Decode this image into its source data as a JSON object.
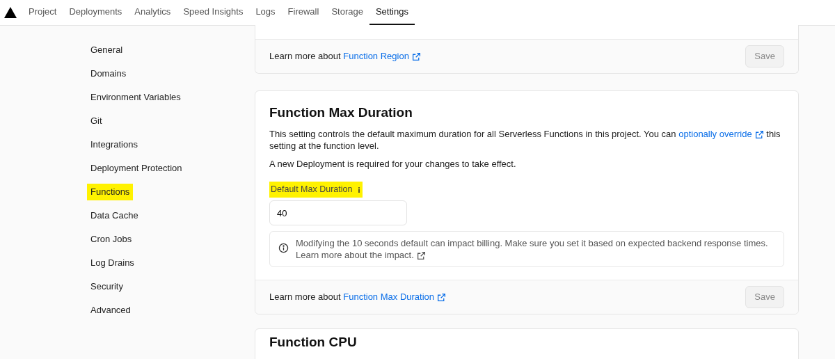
{
  "nav": {
    "tabs": [
      {
        "label": "Project",
        "selected": false
      },
      {
        "label": "Deployments",
        "selected": false
      },
      {
        "label": "Analytics",
        "selected": false
      },
      {
        "label": "Speed Insights",
        "selected": false
      },
      {
        "label": "Logs",
        "selected": false
      },
      {
        "label": "Firewall",
        "selected": false
      },
      {
        "label": "Storage",
        "selected": false
      },
      {
        "label": "Settings",
        "selected": true
      }
    ]
  },
  "sidebar": {
    "items": [
      {
        "label": "General",
        "highlighted": false
      },
      {
        "label": "Domains",
        "highlighted": false
      },
      {
        "label": "Environment Variables",
        "highlighted": false
      },
      {
        "label": "Git",
        "highlighted": false
      },
      {
        "label": "Integrations",
        "highlighted": false
      },
      {
        "label": "Deployment Protection",
        "highlighted": false
      },
      {
        "label": "Functions",
        "highlighted": true
      },
      {
        "label": "Data Cache",
        "highlighted": false
      },
      {
        "label": "Cron Jobs",
        "highlighted": false
      },
      {
        "label": "Log Drains",
        "highlighted": false
      },
      {
        "label": "Security",
        "highlighted": false
      },
      {
        "label": "Advanced",
        "highlighted": false
      }
    ]
  },
  "region_card": {
    "footer_text": "Learn more about",
    "footer_link": "Function Region",
    "save": {
      "label": "Save",
      "disabled": true
    }
  },
  "duration_card": {
    "title": "Function Max Duration",
    "description_before": "This setting controls the default maximum duration for all Serverless Functions in this project. You can",
    "description_link": "optionally override",
    "description_after": "this setting at the function level.",
    "note": "A new Deployment is required for your changes to take effect.",
    "field_label": "Default Max Duration",
    "field_label_highlighted": true,
    "field_value": "40",
    "info_text": "Modifying the 10 seconds default can impact billing. Make sure you set it based on expected backend response times.",
    "info_link": "Learn more about the impact.",
    "footer_text": "Learn more about",
    "footer_link": "Function Max Duration",
    "save": {
      "label": "Save",
      "disabled": true
    }
  },
  "cpu_card": {
    "title": "Function CPU"
  }
}
